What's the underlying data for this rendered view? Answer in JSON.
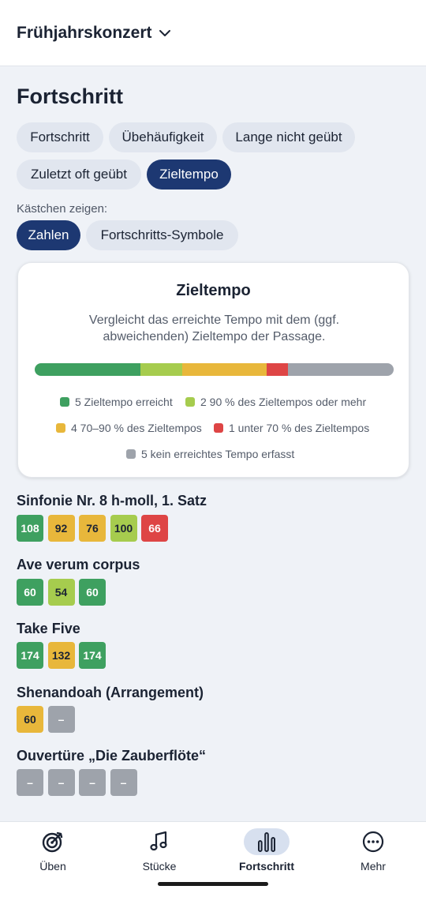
{
  "header": {
    "title": "Frühjahrskonzert"
  },
  "page": {
    "title": "Fortschritt"
  },
  "filter_chips": [
    {
      "label": "Fortschritt",
      "active": false
    },
    {
      "label": "Übehäufigkeit",
      "active": false
    },
    {
      "label": "Lange nicht geübt",
      "active": false
    },
    {
      "label": "Zuletzt oft geübt",
      "active": false
    },
    {
      "label": "Zieltempo",
      "active": true
    }
  ],
  "display": {
    "label": "Kästchen zeigen:",
    "options": [
      {
        "label": "Zahlen",
        "active": true
      },
      {
        "label": "Fortschritts-Symbole",
        "active": false
      }
    ]
  },
  "colors": {
    "green": "#3ea060",
    "lightgreen": "#a6cc4e",
    "yellow": "#e8b73b",
    "red": "#de4545",
    "gray": "#9ea3ab",
    "accent": "#1d3872"
  },
  "info_card": {
    "title": "Zieltempo",
    "description": "Vergleicht das erreichte Tempo mit dem (ggf. abweichenden) Zieltempo der Passage.",
    "distribution": [
      {
        "color": "green",
        "count": 5
      },
      {
        "color": "lightgreen",
        "count": 2
      },
      {
        "color": "yellow",
        "count": 4
      },
      {
        "color": "red",
        "count": 1
      },
      {
        "color": "gray",
        "count": 5
      }
    ],
    "legend": [
      {
        "color": "green",
        "text": "5 Zieltempo erreicht"
      },
      {
        "color": "lightgreen",
        "text": "2 90 % des Zieltempos oder mehr"
      },
      {
        "color": "yellow",
        "text": "4 70–90 % des Zieltempos"
      },
      {
        "color": "red",
        "text": "1 unter 70 % des Zieltempos"
      },
      {
        "color": "gray",
        "text": "5 kein erreichtes Tempo erfasst"
      }
    ]
  },
  "pieces": [
    {
      "title": "Sinfonie Nr. 8 h-moll, 1. Satz",
      "boxes": [
        {
          "value": "108",
          "color": "green"
        },
        {
          "value": "92",
          "color": "yellow"
        },
        {
          "value": "76",
          "color": "yellow"
        },
        {
          "value": "100",
          "color": "lightgreen"
        },
        {
          "value": "66",
          "color": "red"
        }
      ]
    },
    {
      "title": "Ave verum corpus",
      "boxes": [
        {
          "value": "60",
          "color": "green"
        },
        {
          "value": "54",
          "color": "lightgreen"
        },
        {
          "value": "60",
          "color": "green"
        }
      ]
    },
    {
      "title": "Take Five",
      "boxes": [
        {
          "value": "174",
          "color": "green"
        },
        {
          "value": "132",
          "color": "yellow"
        },
        {
          "value": "174",
          "color": "green"
        }
      ]
    },
    {
      "title": "Shenandoah (Arrangement)",
      "boxes": [
        {
          "value": "60",
          "color": "yellow"
        },
        {
          "value": "–",
          "color": "gray"
        }
      ]
    },
    {
      "title": "Ouvertüre „Die Zauberflöte“",
      "boxes": [
        {
          "value": "–",
          "color": "gray"
        },
        {
          "value": "–",
          "color": "gray"
        },
        {
          "value": "–",
          "color": "gray"
        },
        {
          "value": "–",
          "color": "gray"
        }
      ]
    }
  ],
  "bottom_nav": [
    {
      "label": "Üben",
      "icon": "target-icon",
      "active": false
    },
    {
      "label": "Stücke",
      "icon": "music-note-icon",
      "active": false
    },
    {
      "label": "Fortschritt",
      "icon": "bar-chart-icon",
      "active": true
    },
    {
      "label": "Mehr",
      "icon": "more-icon",
      "active": false
    }
  ]
}
